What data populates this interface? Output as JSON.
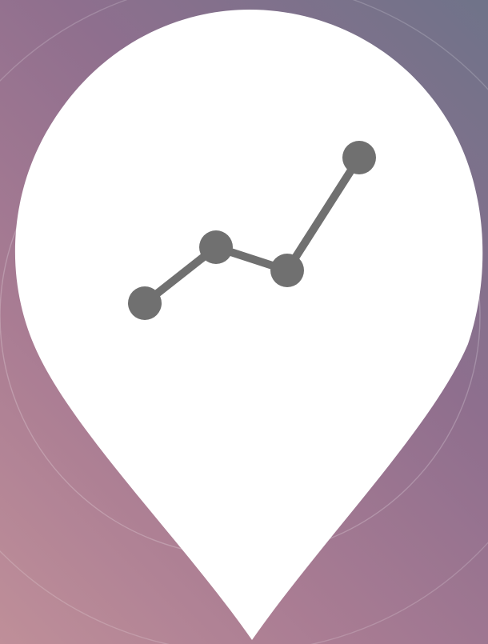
{
  "colors": {
    "background_top_right": "#6f7389",
    "background_mid": "#8f6f8e",
    "background_bottom_left": "#bf8f99",
    "pin_fill": "#ffffff",
    "decor_ring": "#ffffff",
    "chart_icon": "#707070"
  },
  "icons": {
    "pin": "map-pin-icon",
    "chart": "line-chart-icon"
  }
}
